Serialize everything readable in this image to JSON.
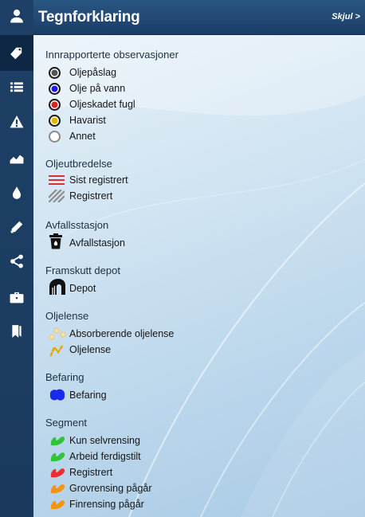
{
  "header": {
    "title": "Tegnforklaring",
    "hide_label": "Skjul >"
  },
  "sidebar": {
    "items": [
      {
        "icon": "user-icon"
      },
      {
        "icon": "tag-icon",
        "active": true
      },
      {
        "icon": "list-icon"
      },
      {
        "icon": "warning-icon"
      },
      {
        "icon": "area-chart-icon"
      },
      {
        "icon": "drop-icon"
      },
      {
        "icon": "pencil-icon"
      },
      {
        "icon": "share-icon"
      },
      {
        "icon": "briefcase-icon"
      },
      {
        "icon": "bookmark-icon"
      }
    ]
  },
  "legend": {
    "observations": {
      "title": "Innrapporterte observasjoner",
      "items": [
        {
          "label": "Oljepåslag",
          "color": "#555555"
        },
        {
          "label": "Olje på vann",
          "color": "#1a1aee"
        },
        {
          "label": "Oljeskadet fugl",
          "color": "#e21d1d"
        },
        {
          "label": "Havarist",
          "color": "#e3b400"
        },
        {
          "label": "Annet",
          "color": "#ffffff"
        }
      ]
    },
    "spread": {
      "title": "Oljeutbredelse",
      "items": [
        {
          "label": "Sist registrert",
          "color": "#d6322f"
        },
        {
          "label": "Registrert",
          "color": "#8c8c8c"
        }
      ]
    },
    "waste": {
      "title": "Avfallsstasjon",
      "items": [
        {
          "label": "Avfallstasjon"
        }
      ]
    },
    "depot": {
      "title": "Framskutt depot",
      "items": [
        {
          "label": "Depot"
        }
      ]
    },
    "boom": {
      "title": "Oljelense",
      "items": [
        {
          "label": "Absorberende oljelense",
          "color": "#f5d06a"
        },
        {
          "label": "Oljelense",
          "color": "#e6a800"
        }
      ]
    },
    "inspection": {
      "title": "Befaring",
      "items": [
        {
          "label": "Befaring",
          "color": "#1a2be8"
        }
      ]
    },
    "segment": {
      "title": "Segment",
      "items": [
        {
          "label": "Kun selvrensing",
          "color": "#2fc43a"
        },
        {
          "label": "Arbeid ferdigstilt",
          "color": "#2fc43a"
        },
        {
          "label": "Registrert",
          "color": "#ee2e2e"
        },
        {
          "label": "Grovrensing pågår",
          "color": "#f3941a"
        },
        {
          "label": "Finrensing pågår",
          "color": "#f3941a"
        }
      ]
    }
  }
}
